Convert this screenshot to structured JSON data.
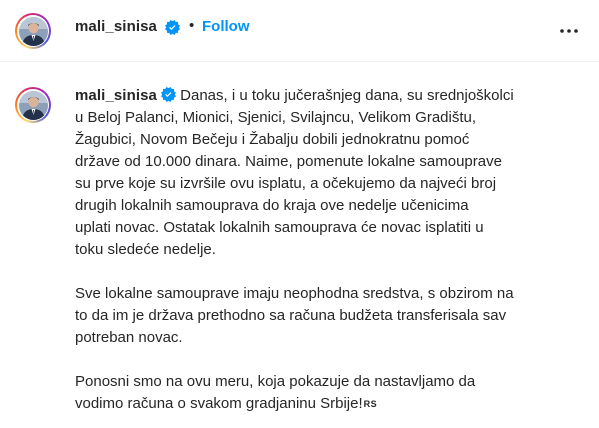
{
  "post": {
    "username": "mali_sinisa",
    "follow_label": "Follow",
    "separator": "•",
    "verified_icon": "verified-badge-icon",
    "more_icon": "more-options-icon",
    "accent_color": "#0095f6"
  },
  "caption": {
    "username": "mali_sinisa",
    "lines_p1": [
      "Danas, i u toku jučerašnjeg dana, su srednjoškolci",
      "u Beloj Palanci, Mionici, Sjenici, Svilajncu, Velikom Gradištu,",
      "Žagubici, Novom Bečeju i Žabalju dobili jednokratnu pomoć",
      "države od 10.000 dinara. Naime, pomenute lokalne samouprave",
      "su prve koje su izvršile ovu isplatu, a očekujemo da najveći broj",
      "drugih lokalnih samouprava do kraja ove nedelje učenicima",
      "uplati novac. Ostatak lokalnih samouprava će novac isplatiti u",
      "toku sledeće nedelje."
    ],
    "lines_p2": [
      "Sve lokalne samouprave imaju neophodna sredstva, s obzirom na",
      "to da im je država prethodno sa računa budžeta transferisala sav",
      "potreban novac."
    ],
    "lines_p3": [
      "Ponosni smo na ovu meru, koja pokazuje da nastavljamo da",
      "vodimo računa o svakom gradjaninu Srbije!"
    ],
    "flag_badge": "RS"
  }
}
